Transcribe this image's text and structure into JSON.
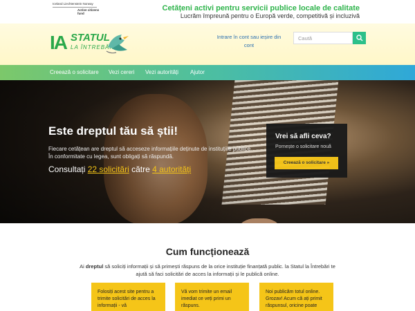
{
  "funding": {
    "sponsor_1": "Iceland Liechtenstein Norway",
    "sponsor_2": "Active citizens fund",
    "title": "Cetățeni activi pentru servicii publice locale de calitate",
    "subtitle": "Lucrăm împreună pentru o Europă verde, competitivă și incluzivă"
  },
  "header": {
    "logo_ia": "IA",
    "logo_statul": "STATUL",
    "logo_intrebari": "LA ÎNTREBĂRI",
    "login_label": "Intrare în cont sau ieșire din cont",
    "search_placeholder": "Caută",
    "icons": {
      "search": "search-icon",
      "logo": "bird-logo-icon"
    },
    "accent": "#2cc08a"
  },
  "nav": {
    "items": [
      "Creează o solicitare",
      "Vezi cereri",
      "Vezi autorități",
      "Ajutor"
    ]
  },
  "hero": {
    "title": "Este dreptul tău să știi!",
    "text": "Fiecare cetățean are dreptul să acceseze informațiile deținute de instituțiile publice. În conformitate cu legea, sunt obligați să răspundă.",
    "stats_prefix": "Consultați",
    "stats_requests": "22 solicitări",
    "stats_middle": "către",
    "stats_authorities": "4 autorități",
    "card_title": "Vrei să afli ceva?",
    "card_sub": "Pornește o solicitare nouă",
    "card_button": "Creează o solicitare »",
    "highlight_color": "#f5c518"
  },
  "how": {
    "title": "Cum funcționează",
    "text_prefix": "Ai",
    "text_bold": "dreptul",
    "text_rest": "să soliciți informații și să primești răspuns de la orice instituție finanțată public. la Statul la Întrebări te ajută să faci solicitări de acces la informații și le publică online.",
    "steps": [
      "Folosiți acest site pentru a trimite solicitări de acces la informații - vă",
      "Vă vom trimite un email imediat ce veți primi un răspuns.",
      "Noi publicăm totul online. Grozav! Acum că ați primit răspunsul, oricine poate"
    ]
  }
}
